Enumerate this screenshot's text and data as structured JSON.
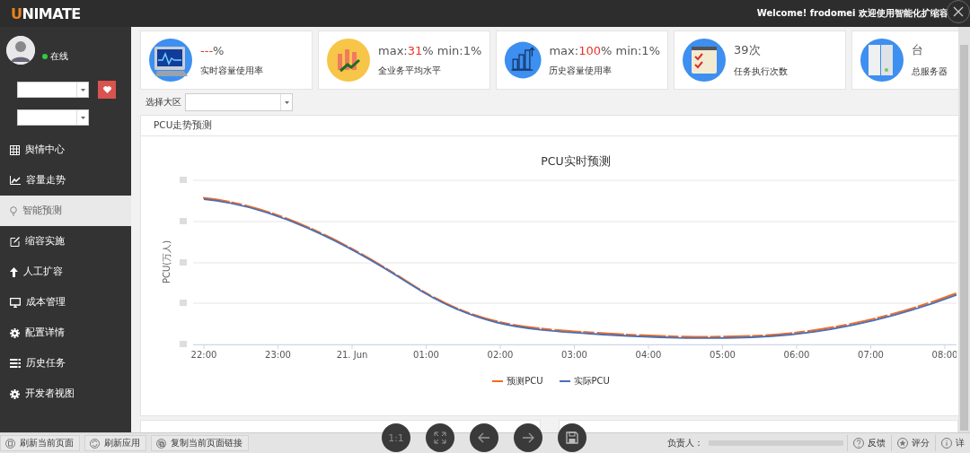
{
  "header": {
    "logo_first": "U",
    "logo_rest": "NIMATE",
    "welcome": "Welcome! frodomei 欢迎使用智能化扩缩容"
  },
  "user": {
    "status": "在线"
  },
  "sidebar": {
    "items": [
      {
        "label": "舆情中心",
        "selected": false
      },
      {
        "label": "容量走势",
        "selected": false
      },
      {
        "label": "智能预测",
        "selected": true
      },
      {
        "label": "缩容实施",
        "selected": false
      },
      {
        "label": "人工扩容",
        "selected": false
      },
      {
        "label": "成本管理",
        "selected": false
      },
      {
        "label": "配置详情",
        "selected": false
      },
      {
        "label": "历史任务",
        "selected": false
      },
      {
        "label": "开发者视图",
        "selected": false
      }
    ]
  },
  "cards": [
    {
      "value": [
        {
          "text": "---",
          "highlight": true
        },
        {
          "text": "%",
          "highlight": false
        }
      ],
      "label": "实时容量使用率"
    },
    {
      "value": [
        {
          "text": "max:",
          "highlight": false
        },
        {
          "text": "31",
          "highlight": true
        },
        {
          "text": "% min:1%",
          "highlight": false
        }
      ],
      "label": "全业务平均水平"
    },
    {
      "value": [
        {
          "text": "max:",
          "highlight": false
        },
        {
          "text": "100",
          "highlight": true
        },
        {
          "text": "% min:1%",
          "highlight": false
        }
      ],
      "label": "历史容量使用率"
    },
    {
      "value": [
        {
          "text": "39次",
          "highlight": false
        }
      ],
      "label": "任务执行次数"
    },
    {
      "value": [
        {
          "text": "台",
          "highlight": false
        }
      ],
      "label": "总服务器"
    }
  ],
  "region": {
    "label": "选择大区"
  },
  "panel": {
    "title": "PCU走势预测"
  },
  "chart": {
    "title": "PCU实时预测",
    "ylabel": "PCU(万人)",
    "xlabels": [
      "22:00",
      "23:00",
      "21. Jun",
      "01:00",
      "02:00",
      "03:00",
      "04:00",
      "05:00",
      "06:00",
      "07:00",
      "08:00"
    ],
    "legend": [
      {
        "name": "预测PCU",
        "color": "#f26b21"
      },
      {
        "name": "实际PCU",
        "color": "#4a6fb5"
      }
    ]
  },
  "viewer": {
    "zoom_label": "1:1"
  },
  "footer": {
    "buttons": [
      "刷新当前页面",
      "刷新应用",
      "复制当前页面链接"
    ],
    "owner_label": "负责人：",
    "right_buttons": [
      "反馈",
      "评分",
      "详"
    ]
  }
}
